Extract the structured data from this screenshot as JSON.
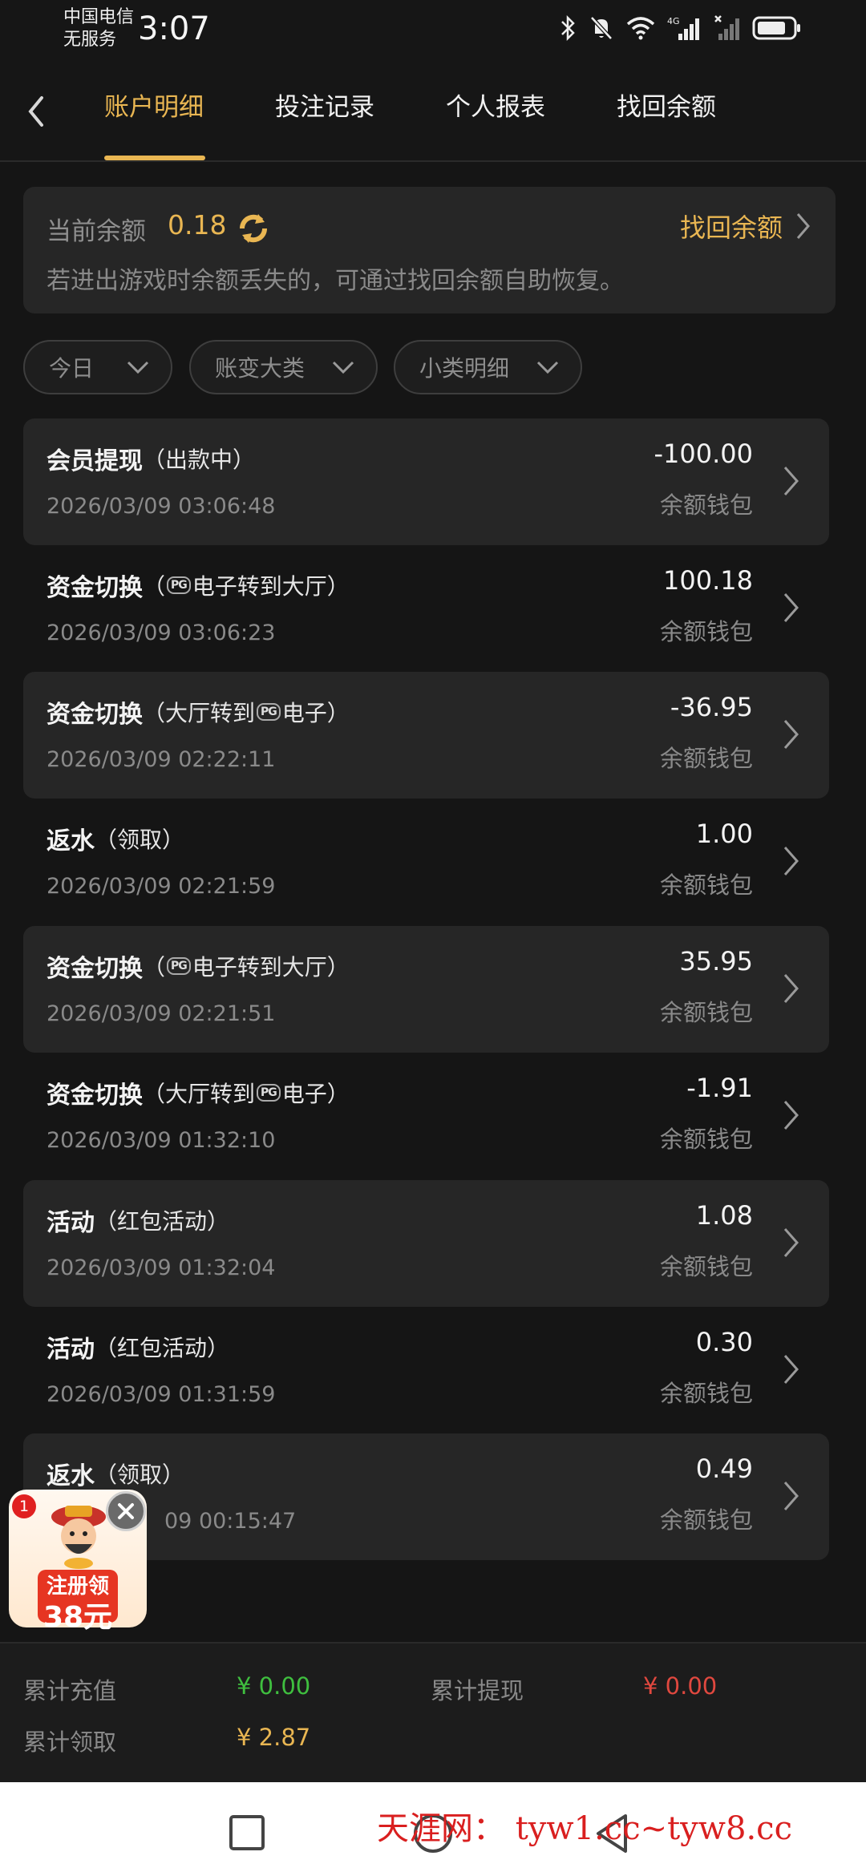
{
  "status": {
    "carrier_line1": "中国电信",
    "carrier_line2": "无服务",
    "time": "3:07",
    "network": "4G"
  },
  "nav": {
    "tabs": [
      {
        "label": "账户明细",
        "active": true
      },
      {
        "label": "投注记录",
        "active": false
      },
      {
        "label": "个人报表",
        "active": false
      },
      {
        "label": "找回余额",
        "active": false
      }
    ]
  },
  "balance": {
    "label": "当前余额",
    "value": "0.18",
    "recover_label": "找回余额",
    "hint": "若进出游戏时余额丢失的，可通过找回余额自助恢复。"
  },
  "filters": [
    {
      "label": "今日"
    },
    {
      "label": "账变大类"
    },
    {
      "label": "小类明细"
    }
  ],
  "transactions": [
    {
      "type": "会员提现",
      "sub_pre": "（出款中）",
      "pg": "",
      "sub_post": "",
      "time": "2026/03/09 03:06:48",
      "amount": "-100.00",
      "wallet": "余额钱包"
    },
    {
      "type": "资金切换",
      "sub_pre": "（",
      "pg": "PG",
      "sub_post": "电子转到大厅）",
      "time": "2026/03/09 03:06:23",
      "amount": "100.18",
      "wallet": "余额钱包"
    },
    {
      "type": "资金切换",
      "sub_pre": "（大厅转到",
      "pg": "PG",
      "sub_post": "电子）",
      "time": "2026/03/09 02:22:11",
      "amount": "-36.95",
      "wallet": "余额钱包"
    },
    {
      "type": "返水",
      "sub_pre": "（领取）",
      "pg": "",
      "sub_post": "",
      "time": "2026/03/09 02:21:59",
      "amount": "1.00",
      "wallet": "余额钱包"
    },
    {
      "type": "资金切换",
      "sub_pre": "（",
      "pg": "PG",
      "sub_post": "电子转到大厅）",
      "time": "2026/03/09 02:21:51",
      "amount": "35.95",
      "wallet": "余额钱包"
    },
    {
      "type": "资金切换",
      "sub_pre": "（大厅转到",
      "pg": "PG",
      "sub_post": "电子）",
      "time": "2026/03/09 01:32:10",
      "amount": "-1.91",
      "wallet": "余额钱包"
    },
    {
      "type": "活动",
      "sub_pre": "（红包活动）",
      "pg": "",
      "sub_post": "",
      "time": "2026/03/09 01:32:04",
      "amount": "1.08",
      "wallet": "余额钱包"
    },
    {
      "type": "活动",
      "sub_pre": "（红包活动）",
      "pg": "",
      "sub_post": "",
      "time": "2026/03/09 01:31:59",
      "amount": "0.30",
      "wallet": "余额钱包"
    },
    {
      "type": "返水",
      "sub_pre": "（领取）",
      "pg": "",
      "sub_post": "",
      "time": "09 00:15:47",
      "amount": "0.49",
      "wallet": "余额钱包"
    }
  ],
  "promo": {
    "badge": "1",
    "line1": "注册领",
    "line2": "38元"
  },
  "summary": {
    "recharge_label": "累计充值",
    "recharge_value": "¥ 0.00",
    "withdraw_label": "累计提现",
    "withdraw_value": "¥ 0.00",
    "claimed_label": "累计领取",
    "claimed_value": "¥ 2.87"
  },
  "watermark": "天涯网： tyw1.cc~tyw8.cc",
  "colors": {
    "accent": "#e9b652",
    "positive": "#3fbf3f",
    "negative": "#e0483f",
    "background": "#151515",
    "card": "#262626"
  }
}
